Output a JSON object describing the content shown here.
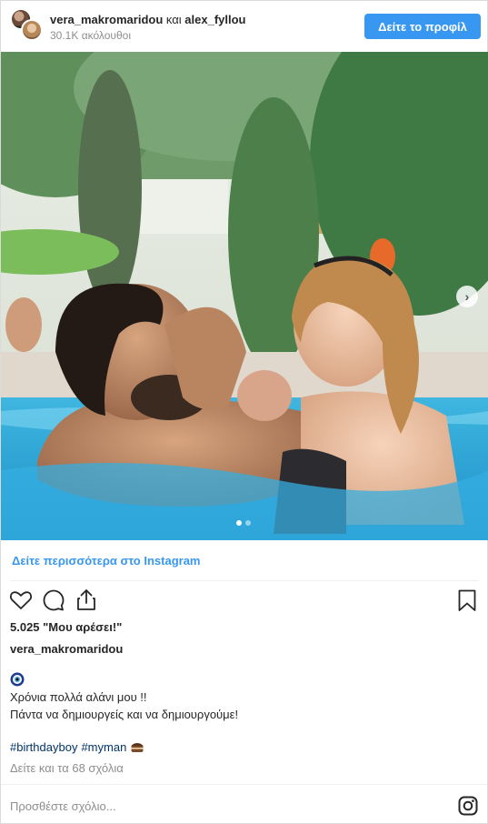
{
  "header": {
    "user1": "vera_makromaridou",
    "connector": "και",
    "user2": "alex_fyllou",
    "followers": "30.1K ακόλουθοι",
    "profile_button": "Δείτε το προφίλ"
  },
  "carousel": {
    "current": 1,
    "total": 2
  },
  "footer": {
    "more_link": "Δείτε περισσότερα στο Instagram",
    "likes": "5.025 \"Μου αρέσει!\"",
    "caption_user": "vera_makromaridou",
    "caption_line1": "Χρόνια πολλά αλάνι μου !!",
    "caption_line2": "Πάντα να δημιουργείς και να δημιουργούμε!",
    "hashtag1": "#birthdayboy",
    "hashtag2": "#myman",
    "comments_link": "Δείτε και τα 68 σχόλια",
    "comment_placeholder": "Προσθέστε σχόλιο..."
  },
  "icons": {
    "like": "heart-icon",
    "comment": "comment-icon",
    "share": "share-icon",
    "save": "bookmark-icon",
    "next": "chevron-right-icon",
    "logo": "instagram-logo-icon",
    "emoji1": "nazar-amulet-emoji",
    "emoji2": "cake-emoji"
  },
  "colors": {
    "accent": "#3897f0",
    "hashtag": "#003569",
    "muted": "#8e8e8e"
  }
}
